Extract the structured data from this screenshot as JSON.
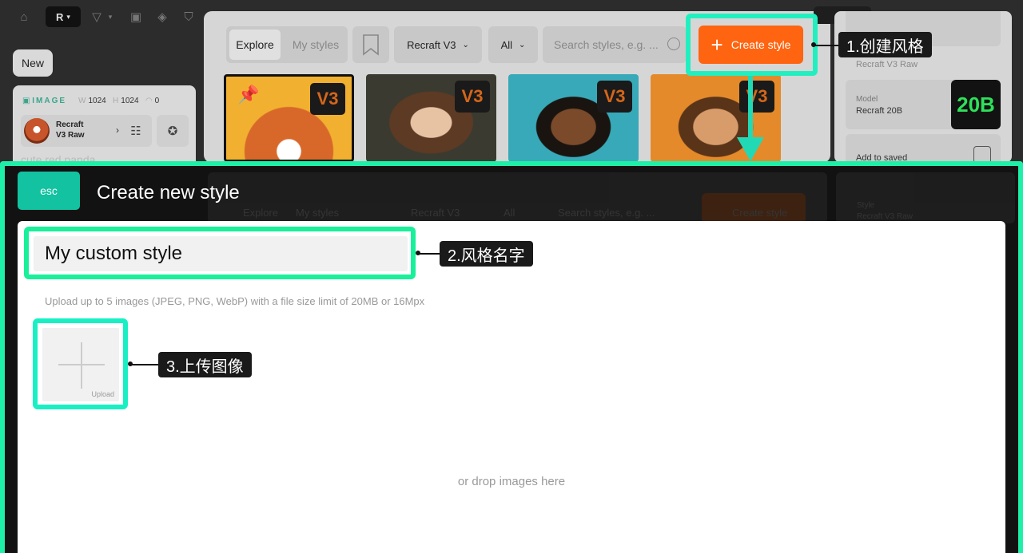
{
  "topbar": {
    "icons": [
      "home-icon",
      "logo",
      "vector-icon",
      "image-icon",
      "sticker-icon",
      "shirt-icon"
    ]
  },
  "sidebar": {
    "new_label": "New",
    "image_label": "IMAGE",
    "width_key": "W",
    "width_value": "1024",
    "height_key": "H",
    "height_value": "1024",
    "count_value": "0",
    "model_line1": "Recraft",
    "model_line2": "V3 Raw",
    "prompt_ghost": "cute red panda"
  },
  "style_panel": {
    "tab_explore": "Explore",
    "tab_my_styles": "My styles",
    "model_dropdown": "Recraft V3",
    "filter_dropdown": "All",
    "search_placeholder": "Search styles, e.g. ...",
    "create_button": "Create style",
    "thumbnails": [
      {
        "badge": "V3",
        "subject": "red panda"
      },
      {
        "badge": "V3",
        "subject": "woman portrait"
      },
      {
        "badge": "V3",
        "subject": "man illustration"
      },
      {
        "badge": "V3",
        "subject": "man portrait"
      }
    ]
  },
  "right_panel": {
    "style_value": "Recraft V3 Raw",
    "model_label": "Model",
    "model_value": "Recraft 20B",
    "model_badge": "20B",
    "add_to_saved": "Add to saved"
  },
  "annotations": {
    "step1": "1.创建风格",
    "step2": "2.风格名字",
    "step3": "3.上传图像"
  },
  "modal": {
    "esc_label": "esc",
    "title": "Create new style",
    "ghost_style_label": "Style",
    "name_value": "My custom style",
    "upload_hint": "Upload up to 5 images (JPEG, PNG, WebP) with a file size limit of 20MB or 16Mpx",
    "upload_label": "Upload",
    "drop_text": "or drop images here"
  },
  "colors": {
    "accent_orange": "#ff6410",
    "highlight_green": "#1ff0a8",
    "esc_teal": "#12c2a0",
    "badge_green": "#2ee05a"
  }
}
